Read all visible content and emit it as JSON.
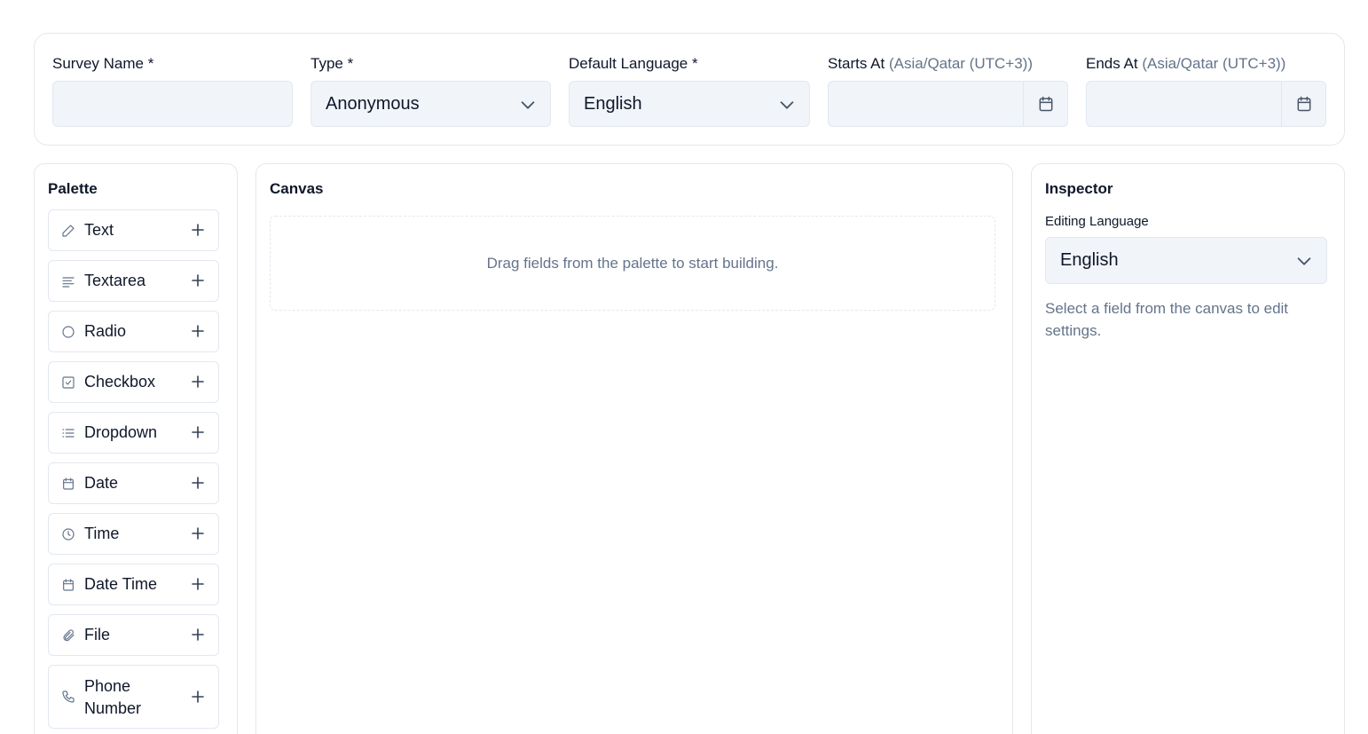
{
  "header": {
    "survey_name": {
      "label": "Survey Name *",
      "value": "",
      "placeholder": ""
    },
    "type": {
      "label": "Type *",
      "value": "Anonymous"
    },
    "default_language": {
      "label": "Default Language *",
      "value": "English"
    },
    "starts_at": {
      "label": "Starts At",
      "hint": "(Asia/Qatar (UTC+3))",
      "value": ""
    },
    "ends_at": {
      "label": "Ends At",
      "hint": "(Asia/Qatar (UTC+3))",
      "value": ""
    }
  },
  "palette": {
    "title": "Palette",
    "items": [
      {
        "label": "Text",
        "icon": "pencil-icon"
      },
      {
        "label": "Textarea",
        "icon": "text-lines-icon"
      },
      {
        "label": "Radio",
        "icon": "circle-icon"
      },
      {
        "label": "Checkbox",
        "icon": "checkbox-icon"
      },
      {
        "label": "Dropdown",
        "icon": "list-icon"
      },
      {
        "label": "Date",
        "icon": "calendar-icon"
      },
      {
        "label": "Time",
        "icon": "clock-icon"
      },
      {
        "label": "Date Time",
        "icon": "calendar-icon"
      },
      {
        "label": "File",
        "icon": "paperclip-icon"
      },
      {
        "label": "Phone Number",
        "icon": "phone-icon"
      }
    ]
  },
  "canvas": {
    "title": "Canvas",
    "empty_message": "Drag fields from the palette to start building."
  },
  "inspector": {
    "title": "Inspector",
    "editing_language_label": "Editing Language",
    "editing_language_value": "English",
    "help_text": "Select a field from the canvas to edit settings."
  }
}
